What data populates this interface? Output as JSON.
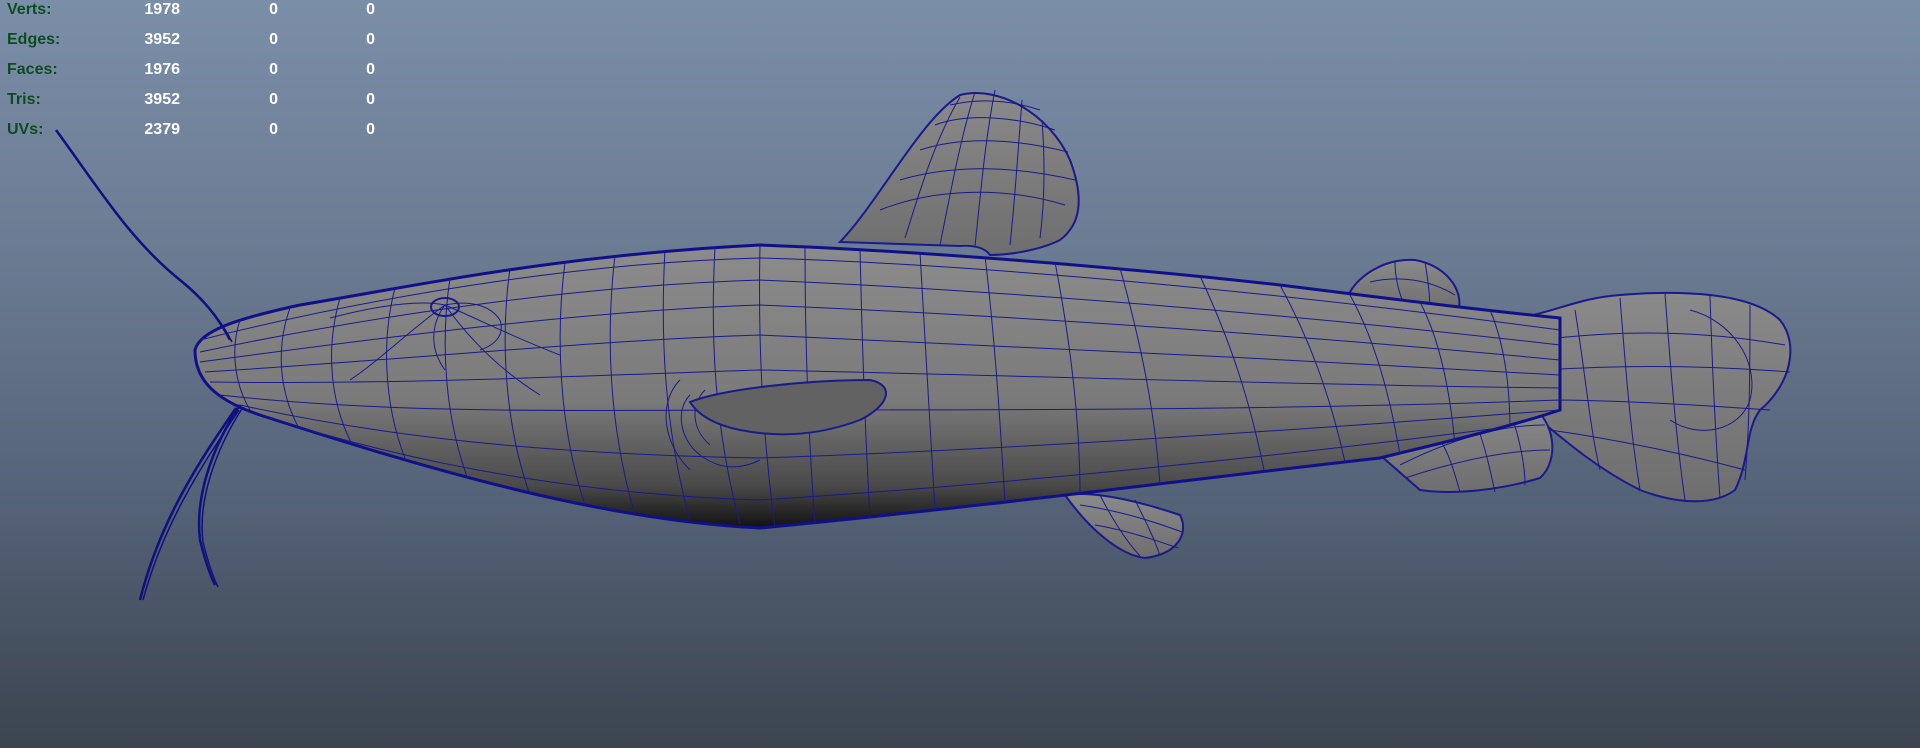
{
  "viewport": {
    "background_top": "#7b8ea8",
    "background_bottom": "#3b444f",
    "wire_color": "#1a1a8c",
    "shade_color": "#7d7d7d"
  },
  "hud": {
    "rows": [
      {
        "label": "Verts:",
        "values": [
          "1978",
          "0",
          "0"
        ]
      },
      {
        "label": "Edges:",
        "values": [
          "3952",
          "0",
          "0"
        ]
      },
      {
        "label": "Faces:",
        "values": [
          "1976",
          "0",
          "0"
        ]
      },
      {
        "label": "Tris:",
        "values": [
          "3952",
          "0",
          "0"
        ]
      },
      {
        "label": "UVs:",
        "values": [
          "2379",
          "0",
          "0"
        ]
      }
    ]
  },
  "model": {
    "icon": "catfish-mesh-wireframe"
  }
}
